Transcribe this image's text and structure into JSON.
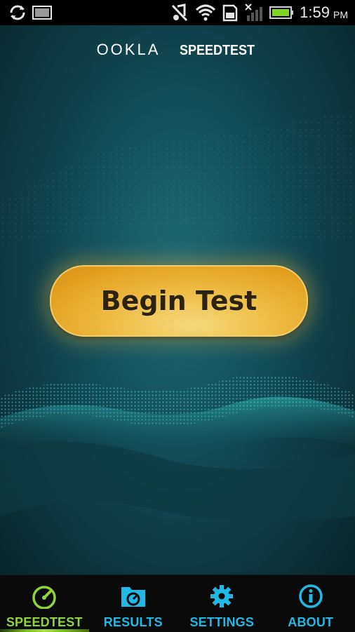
{
  "status_bar": {
    "time": "1:59",
    "ampm": "PM",
    "icons": [
      "sync-icon",
      "image-icon",
      "mute-icon",
      "wifi-icon",
      "sd-card-icon",
      "signal-icon",
      "battery-icon"
    ]
  },
  "header": {
    "brand": "OOKLA",
    "product": "SPEEDTEST"
  },
  "main": {
    "begin_button_label": "Begin Test"
  },
  "nav": {
    "items": [
      {
        "label": "SPEEDTEST",
        "icon": "gauge-icon",
        "active": true
      },
      {
        "label": "RESULTS",
        "icon": "folder-gauge-icon",
        "active": false
      },
      {
        "label": "SETTINGS",
        "icon": "gear-icon",
        "active": false
      },
      {
        "label": "ABOUT",
        "icon": "info-icon",
        "active": false
      }
    ]
  },
  "colors": {
    "accent_green": "#8ed43a",
    "accent_blue": "#22b8e6",
    "button_gold": "#efbd45",
    "background_teal": "#155660"
  }
}
